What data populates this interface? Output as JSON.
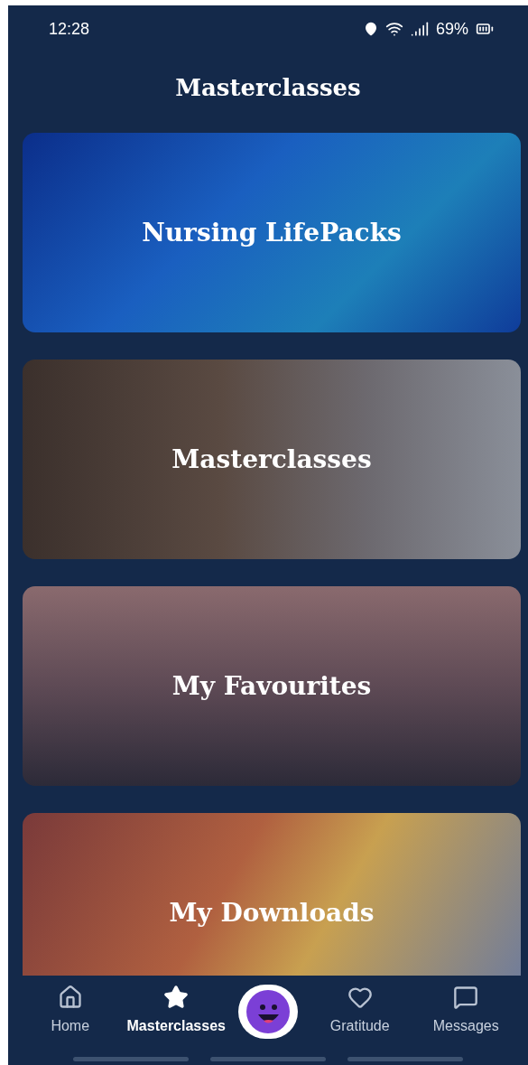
{
  "status_bar": {
    "time": "12:28",
    "battery": "69%"
  },
  "title": "Masterclasses",
  "cards": [
    {
      "title": "Nursing LifePacks",
      "kind": "hearts"
    },
    {
      "title": "Masterclasses",
      "kind": "library"
    },
    {
      "title": "My Favourites",
      "kind": "hands"
    },
    {
      "title": "My Downloads",
      "kind": "blur"
    }
  ],
  "nav": [
    {
      "label": "Home",
      "kind": "home",
      "selected": false
    },
    {
      "label": "Masterclasses",
      "kind": "star",
      "selected": true
    },
    {
      "kind": "avatar",
      "selected": false
    },
    {
      "label": "Gratitude",
      "kind": "heart",
      "selected": false
    },
    {
      "label": "Messages",
      "kind": "message",
      "selected": false
    }
  ]
}
